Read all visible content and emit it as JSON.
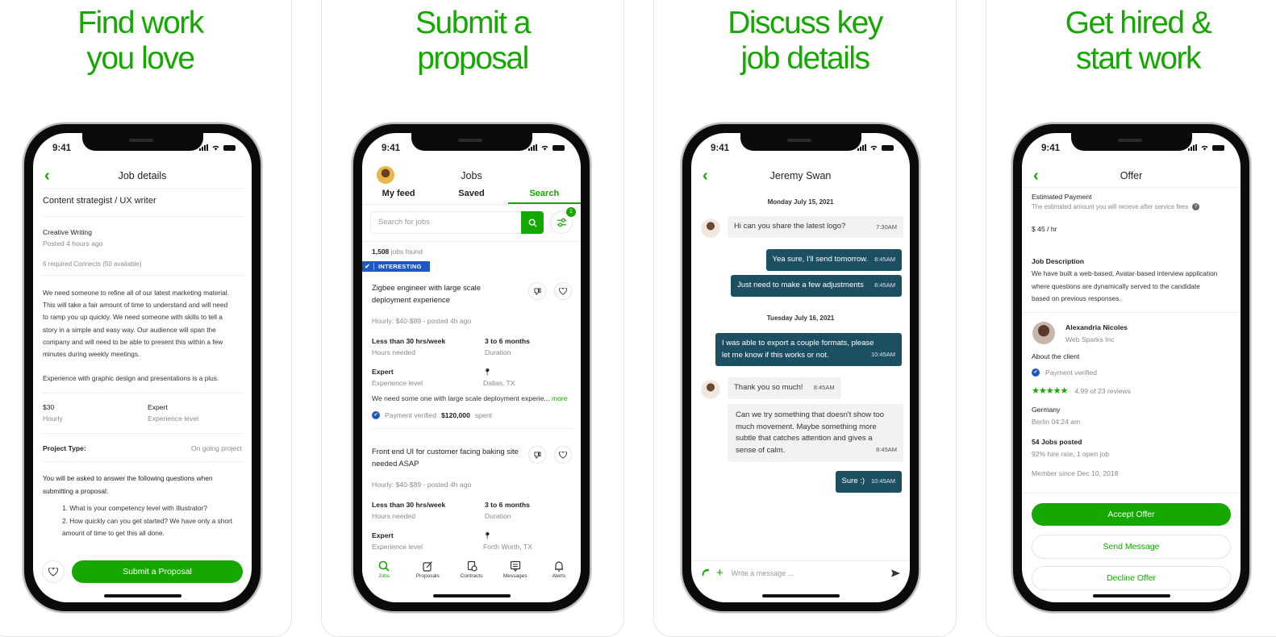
{
  "colors": {
    "brand_green": "#14a800",
    "bubble_dark": "#1d4f63",
    "verified_blue": "#1f57c3"
  },
  "status_bar": {
    "time": "9:41"
  },
  "panels": [
    {
      "headline_line1": "Find work",
      "headline_line2": "you love"
    },
    {
      "headline_line1": "Submit a",
      "headline_line2": "proposal"
    },
    {
      "headline_line1": "Discuss key",
      "headline_line2": "job details"
    },
    {
      "headline_line1": "Get hired &",
      "headline_line2": "start work"
    }
  ],
  "job_details": {
    "nav_title": "Job details",
    "job_title": "Content strategist / UX writer",
    "category": "Creative Writing",
    "posted": "Posted 4 hours ago",
    "connects": "6 required Connects (50 available)",
    "description_lines": [
      "We need someone to refine all of our latest marketing material.",
      "This will take a fair amount of time to understand and will need",
      "to ramp you up quickly. We need someone with skills to tell a",
      "story in a simple and easy way. Our audience will span the",
      "company and will need to be able to present this within a few",
      "minutes during weekly meetings."
    ],
    "description_extra": "Experience with graphic design and presentations is a plus.",
    "rate_value": "$30",
    "rate_label": "Hourly",
    "level_value": "Expert",
    "level_label": "Experience level",
    "project_type_label": "Project Type:",
    "project_type_value": "On going project",
    "questions_intro_1": "You will be asked to answer the following questions when",
    "questions_intro_2": "submitting a proposal:",
    "question_1": "1. What is your competency level with Illustrator?",
    "question_2a": "2. How quickly can you get started? We have only a short",
    "question_2b": "amount of time to get this all done.",
    "submit_label": "Submit a Proposal"
  },
  "jobs": {
    "nav_title": "Jobs",
    "tabs": [
      "My feed",
      "Saved",
      "Search"
    ],
    "active_tab": "Search",
    "search_placeholder": "Search for jobs",
    "filter_badge": "1",
    "results_count": "1,508",
    "results_suffix": "jobs found",
    "banner_label": "INTERESTING",
    "listings": [
      {
        "title_1": "Zigbee engineer with large scale",
        "title_2": "deployment experience",
        "meta": "Hourly: $40-$89 - posted 4h ago",
        "hours_value": "Less than 30 hrs/week",
        "hours_label": "Hours needed",
        "duration_value": "3 to 6 months",
        "duration_label": "Duration",
        "level_value": "Expert",
        "level_label": "Experience level",
        "location": "Dallas, TX",
        "snippet": "We need some one with large scale deployment experie...",
        "more": "more",
        "payment": "Payment verified",
        "spent_value": "$120,000",
        "spent_label": "spent"
      },
      {
        "title_1": "Front end UI for customer facing baking site",
        "title_2": "needed ASAP",
        "meta": "Hourly: $40-$89 - posted 4h ago",
        "hours_value": "Less than 30 hrs/week",
        "hours_label": "Hours needed",
        "duration_value": "3 to 6 months",
        "duration_label": "Duration",
        "level_value": "Expert",
        "level_label": "Experience level",
        "location": "Forth Worth, TX"
      }
    ],
    "tabbar": [
      "Jobs",
      "Proposals",
      "Contracts",
      "Messages",
      "Alerts"
    ]
  },
  "chat": {
    "nav_title": "Jeremy Swan",
    "date_1": "Monday July 15, 2021",
    "date_2": "Tuesday July 16, 2021",
    "messages": [
      {
        "text": "Hi can you share the latest logo?",
        "time": "7:30AM"
      },
      {
        "text": "Yea sure, I'll send tomorrow.",
        "time": "8:45AM"
      },
      {
        "text": "Just need to make a few adjustments",
        "time": "8:45AM"
      },
      {
        "text_1": "I was able to export a couple formats, please",
        "text_2": "let me know if this works or not.",
        "time": "10:45AM"
      },
      {
        "text": "Thank you so much!",
        "time": "8:45AM"
      },
      {
        "text_1": "Can we try something that doesn't show too",
        "text_2": "much movement. Maybe something more",
        "text_3": "subtle that catches attention and gives a",
        "text_4": "sense of calm.",
        "time": "8:45AM"
      },
      {
        "text": "Sure :)",
        "time": "10:45AM"
      }
    ],
    "composer_placeholder": "Write a message ..."
  },
  "offer": {
    "nav_title": "Offer",
    "est_title": "Estimated Payment",
    "est_sub": "The estimated amount you will recieve after service fees",
    "rate": "$ 45 / hr",
    "desc_title": "Job Description",
    "desc_1": "We have built a web-based, Avatar-based interview application",
    "desc_2": "where questions are dynamically served to the candidate",
    "desc_3": "based on previous responses.",
    "client_name": "Alexandria Nicoles",
    "client_company": "Web Sparks Inc",
    "about": "About the client",
    "payment": "Payment verified",
    "rating_value": 4.99,
    "rating_text": "4.99 of 23 reviews",
    "country": "Germany",
    "local_time": "Berlin 04:24 am",
    "jobs_posted": "54 Jobs posted",
    "hire_rate": "92% hire rate, 1 open job",
    "member_since": "Member since Dec 10, 2018",
    "accept": "Accept Offer",
    "message": "Send Message",
    "decline": "Decline Offer"
  }
}
